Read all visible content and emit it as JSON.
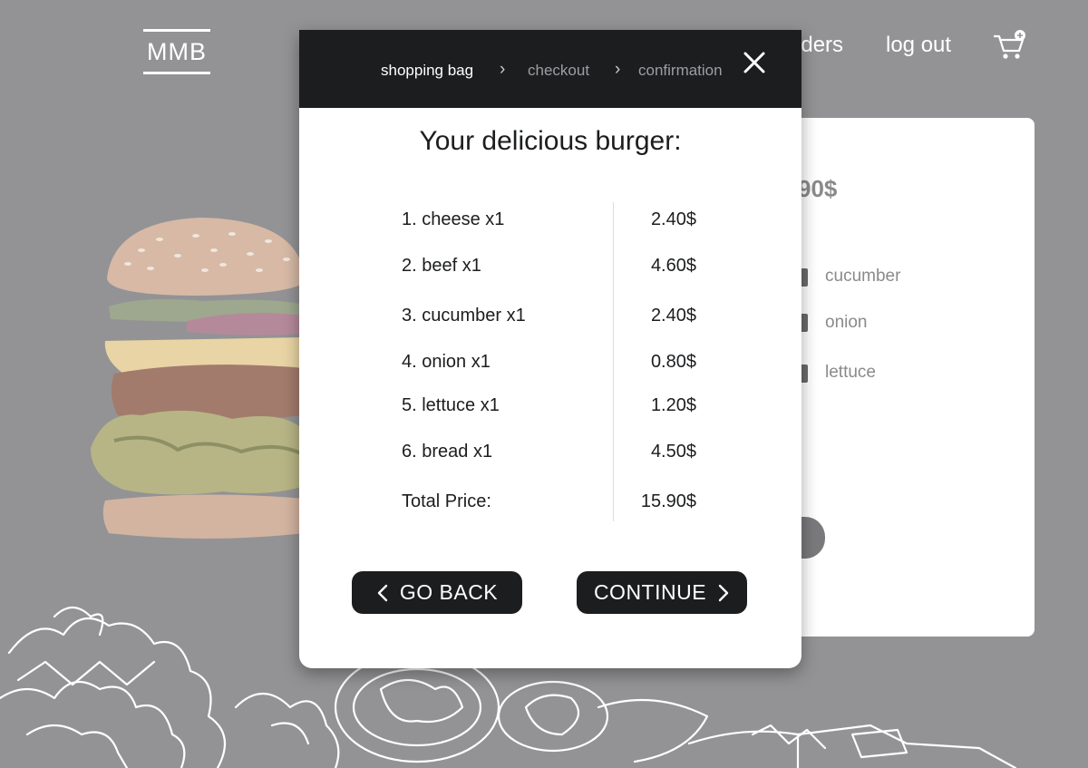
{
  "brand": {
    "logo_text": "MMB"
  },
  "nav": {
    "orders_label": "orders",
    "logout_label": "log out",
    "cart_icon": "cart-plus-icon"
  },
  "background": {
    "price_fragment": "90$",
    "options": [
      {
        "label": "cucumber"
      },
      {
        "label": "onion"
      },
      {
        "label": "lettuce"
      }
    ]
  },
  "modal": {
    "steps": [
      {
        "label": "shopping bag",
        "active": true
      },
      {
        "label": "checkout",
        "active": false
      },
      {
        "label": "confirmation",
        "active": false
      }
    ],
    "title": "Your delicious burger:",
    "items": [
      {
        "name": "1. cheese x1",
        "price": "2.40$"
      },
      {
        "name": "2. beef x1",
        "price": "4.60$"
      },
      {
        "name": "3. cucumber x1",
        "price": "2.40$"
      },
      {
        "name": "4. onion x1",
        "price": "0.80$"
      },
      {
        "name": "5. lettuce x1",
        "price": "1.20$"
      },
      {
        "name": "6. bread x1",
        "price": "4.50$"
      }
    ],
    "total_label": "Total Price:",
    "total_value": "15.90$",
    "back_label": "GO BACK",
    "continue_label": "CONTINUE"
  },
  "colors": {
    "backdrop": "#939395",
    "header": "#1b1d1f",
    "button": "#1b1d1f",
    "inactive_step": "#9c9ea1"
  }
}
